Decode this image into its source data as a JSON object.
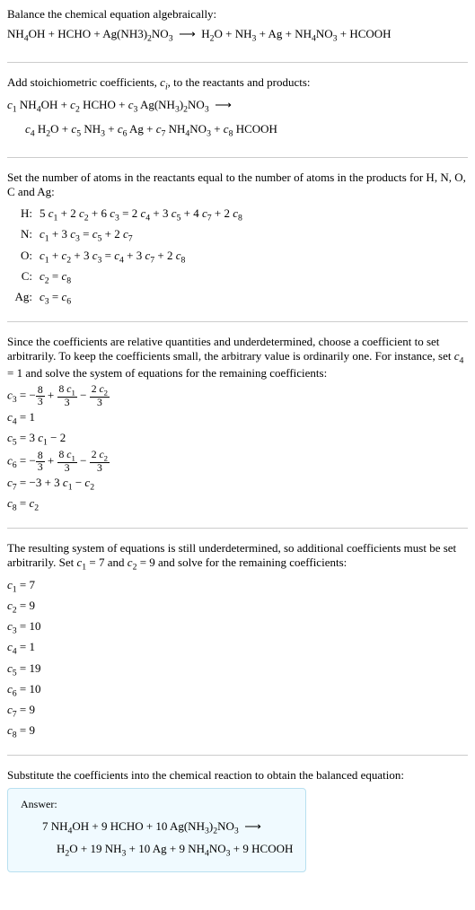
{
  "section1": {
    "intro": "Balance the chemical equation algebraically:",
    "equation_text": "NH₄OH + HCHO + Ag(NH3)₂NO₃ ⟶ H₂O + NH₃ + Ag + NH₄NO₃ + HCOOH"
  },
  "section2": {
    "intro_pre": "Add stoichiometric coefficients, ",
    "intro_ci": "cᵢ",
    "intro_post": ", to the reactants and products:",
    "line1_text": "c₁ NH₄OH + c₂ HCHO + c₃ Ag(NH₃)₂NO₃ ⟶",
    "line2_text": "c₄ H₂O + c₅ NH₃ + c₆ Ag + c₇ NH₄NO₃ + c₈ HCOOH"
  },
  "section3": {
    "intro": "Set the number of atoms in the reactants equal to the number of atoms in the products for H, N, O, C and Ag:",
    "rows": [
      {
        "label": "H:",
        "eq_text": "5 c₁ + 2 c₂ + 6 c₃ = 2 c₄ + 3 c₅ + 4 c₇ + 2 c₈"
      },
      {
        "label": "N:",
        "eq_text": "c₁ + 3 c₃ = c₅ + 2 c₇"
      },
      {
        "label": "O:",
        "eq_text": "c₁ + c₂ + 3 c₃ = c₄ + 3 c₇ + 2 c₈"
      },
      {
        "label": "C:",
        "eq_text": "c₂ = c₈"
      },
      {
        "label": "Ag:",
        "eq_text": "c₃ = c₆"
      }
    ]
  },
  "section4": {
    "intro_text_part1": "Since the coefficients are relative quantities and underdetermined, choose a coefficient to set arbitrarily. To keep the coefficients small, the arbitrary value is ordinarily one. For instance, set ",
    "intro_c4": "c₄ = 1",
    "intro_text_part2": " and solve the system of equations for the remaining coefficients:",
    "rows": [
      {
        "lhs": "c₃",
        "type": "frac",
        "frac1_num": "8",
        "frac1_den": "3",
        "frac2_num": "8 c₁",
        "frac2_den": "3",
        "frac3_num": "2 c₂",
        "frac3_den": "3"
      },
      {
        "lhs": "c₄",
        "type": "simple",
        "rhs": "1"
      },
      {
        "lhs": "c₅",
        "type": "simple",
        "rhs_text": "3 c₁ − 2"
      },
      {
        "lhs": "c₆",
        "type": "frac",
        "frac1_num": "8",
        "frac1_den": "3",
        "frac2_num": "8 c₁",
        "frac2_den": "3",
        "frac3_num": "2 c₂",
        "frac3_den": "3"
      },
      {
        "lhs": "c₇",
        "type": "simple",
        "rhs_text": "−3 + 3 c₁ − c₂"
      },
      {
        "lhs": "c₈",
        "type": "simple",
        "rhs_text": "c₂"
      }
    ]
  },
  "section5": {
    "intro_part1": "The resulting system of equations is still underdetermined, so additional coefficients must be set arbitrarily. Set ",
    "intro_c1": "c₁ = 7",
    "intro_and": " and ",
    "intro_c2": "c₂ = 9",
    "intro_part2": " and solve for the remaining coefficients:",
    "coeffs": [
      {
        "name": "c₁",
        "value": "7"
      },
      {
        "name": "c₂",
        "value": "9"
      },
      {
        "name": "c₃",
        "value": "10"
      },
      {
        "name": "c₄",
        "value": "1"
      },
      {
        "name": "c₅",
        "value": "19"
      },
      {
        "name": "c₆",
        "value": "10"
      },
      {
        "name": "c₇",
        "value": "9"
      },
      {
        "name": "c₈",
        "value": "9"
      }
    ]
  },
  "section6": {
    "intro": "Substitute the coefficients into the chemical reaction to obtain the balanced equation:",
    "answer_label": "Answer:",
    "answer_line1": "7 NH₄OH + 9 HCHO + 10 Ag(NH₃)₂NO₃ ⟶",
    "answer_line2": "H₂O + 19 NH₃ + 10 Ag + 9 NH₄NO₃ + 9 HCOOH"
  }
}
